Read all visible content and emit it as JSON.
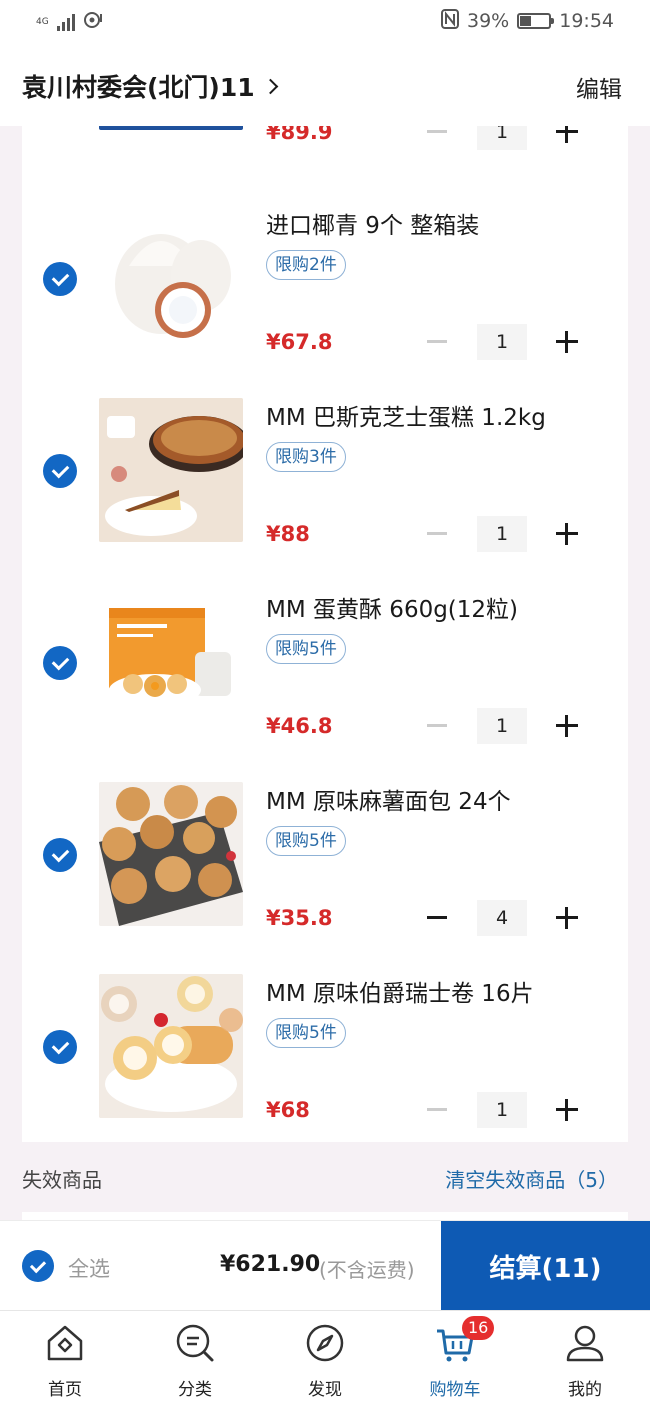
{
  "status_bar": {
    "network": "4G",
    "battery": "39%",
    "battery_level": 0.39,
    "time": "19:54"
  },
  "header": {
    "address": "袁川村委会(北门)11",
    "edit_label": "编辑"
  },
  "cart": {
    "partial_item": {
      "price": "¥89.9",
      "qty": "1"
    },
    "items": [
      {
        "title": "进口椰青 9个 整箱装",
        "limit": "限购2件",
        "price": "¥67.8",
        "qty": "1",
        "minus_active": false
      },
      {
        "title": "MM 巴斯克芝士蛋糕 1.2kg",
        "limit": "限购3件",
        "price": "¥88",
        "qty": "1",
        "minus_active": false
      },
      {
        "title": "MM 蛋黄酥 660g(12粒)",
        "limit": "限购5件",
        "price": "¥46.8",
        "qty": "1",
        "minus_active": false
      },
      {
        "title": "MM 原味麻薯面包 24个",
        "limit": "限购5件",
        "price": "¥35.8",
        "qty": "4",
        "minus_active": true
      },
      {
        "title": "MM 原味伯爵瑞士卷 16片",
        "limit": "限购5件",
        "price": "¥68",
        "qty": "1",
        "minus_active": false
      }
    ]
  },
  "invalid": {
    "label": "失效商品",
    "clear_label": "清空失效商品（5）"
  },
  "checkout": {
    "select_all": "全选",
    "total": "¥621.90",
    "shipping_note": "(不含运费)",
    "pay_label": "结算(11)"
  },
  "tabs": [
    {
      "label": "首页",
      "icon": "home-icon"
    },
    {
      "label": "分类",
      "icon": "category-search-icon"
    },
    {
      "label": "发现",
      "icon": "compass-icon"
    },
    {
      "label": "购物车",
      "icon": "cart-icon",
      "badge": "16"
    },
    {
      "label": "我的",
      "icon": "user-icon"
    }
  ],
  "colors": {
    "accent": "#0e5ab4",
    "price": "#d52a2a",
    "link": "#1f6aa8"
  }
}
